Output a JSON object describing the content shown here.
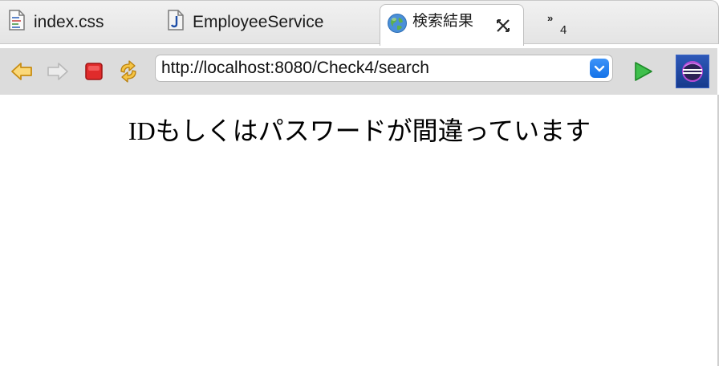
{
  "tabs": [
    {
      "label": "index.css",
      "icon": "css-file-icon",
      "active": false
    },
    {
      "label": "EmployeeService",
      "icon": "java-file-icon",
      "active": false
    },
    {
      "label": "検索結果",
      "icon": "globe-icon",
      "active": true
    }
  ],
  "overflow": {
    "count": "4"
  },
  "toolbar": {
    "back": "back-arrow-icon",
    "forward": "forward-arrow-icon",
    "stop": "stop-icon",
    "refresh": "refresh-icon",
    "go": "go-arrow-icon"
  },
  "address": {
    "url": "http://localhost:8080/Check4/search"
  },
  "page": {
    "message": "IDもしくはパスワードが間違っています"
  },
  "colors": {
    "toolbar_bg": "#dcdcdc",
    "dropdown_accent": "#1e7df0",
    "stop_red": "#e02b2b",
    "go_green": "#2eaa3a"
  }
}
